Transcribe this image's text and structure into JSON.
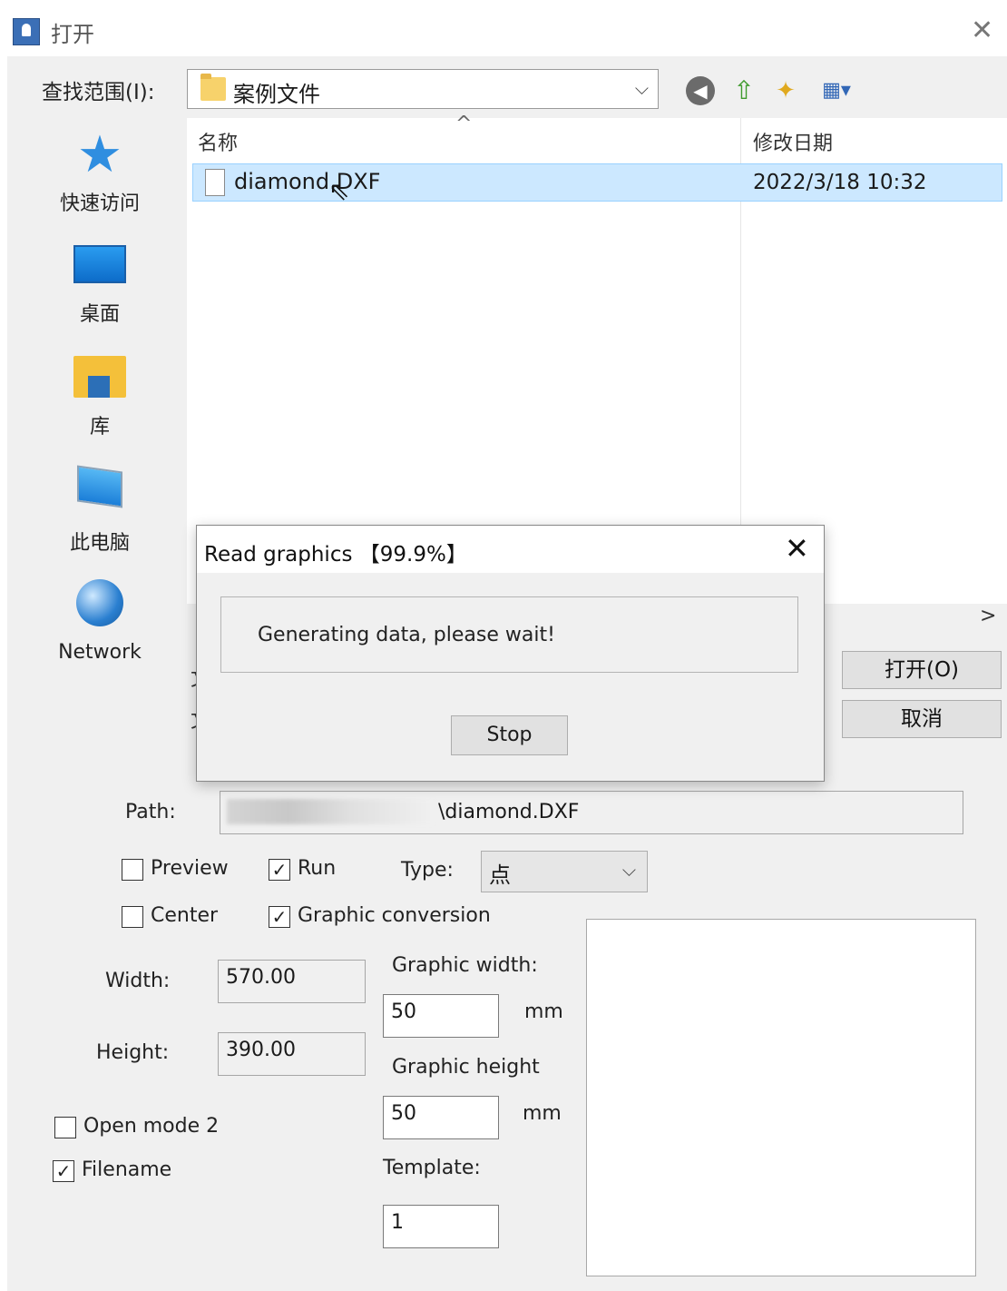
{
  "window": {
    "title": "打开",
    "close_glyph": "✕"
  },
  "lookin": {
    "label": "查找范围(I):",
    "value": "案例文件",
    "dropdown_glyph": "⌵"
  },
  "toolbar": {
    "back_glyph": "◀",
    "up_glyph": "⇧",
    "newfolder_glyph": "✦",
    "view_glyph": "▦▾"
  },
  "places": [
    {
      "label": "快速访问",
      "icon": "star-icon"
    },
    {
      "label": "桌面",
      "icon": "desktop-icon"
    },
    {
      "label": "库",
      "icon": "library-icon"
    },
    {
      "label": "此电脑",
      "icon": "computer-icon"
    },
    {
      "label": "Network",
      "icon": "network-icon"
    }
  ],
  "filelist": {
    "columns": [
      "名称",
      "修改日期"
    ],
    "sort_glyph": "^",
    "rows": [
      {
        "name": "diamond.DXF",
        "date": "2022/3/18 10:32"
      }
    ],
    "scroll_right_glyph": ">"
  },
  "hidden_labels": [
    "文",
    "文"
  ],
  "buttons": {
    "open": "打开(O)",
    "cancel": "取消"
  },
  "form": {
    "path_label": "Path:",
    "path_value": "\\diamond.DXF",
    "preview_label": "Preview",
    "preview_checked": "",
    "run_label": "Run",
    "run_checked": "✓",
    "type_label": "Type:",
    "type_value": "点",
    "type_arrow": "⌵",
    "center_label": "Center",
    "center_checked": "",
    "graphic_conversion_label": "Graphic conversion",
    "graphic_conversion_checked": "✓",
    "width_label": "Width:",
    "width_value": "570.00",
    "height_label": "Height:",
    "height_value": "390.00",
    "graphic_width_label": "Graphic width:",
    "graphic_width_value": "50",
    "graphic_width_unit": "mm",
    "graphic_height_label": "Graphic height",
    "graphic_height_value": "50",
    "graphic_height_unit": "mm",
    "open_mode2_label": "Open mode 2",
    "open_mode2_checked": "",
    "filename_label": "Filename",
    "filename_checked": "✓",
    "template_label": "Template:",
    "template_value": "1"
  },
  "dialog": {
    "title": "Read graphics 【99.9%】",
    "close_glyph": "✕",
    "message": "Generating data, please wait!",
    "stop_label": "Stop",
    "progress_percent": 99.9
  }
}
